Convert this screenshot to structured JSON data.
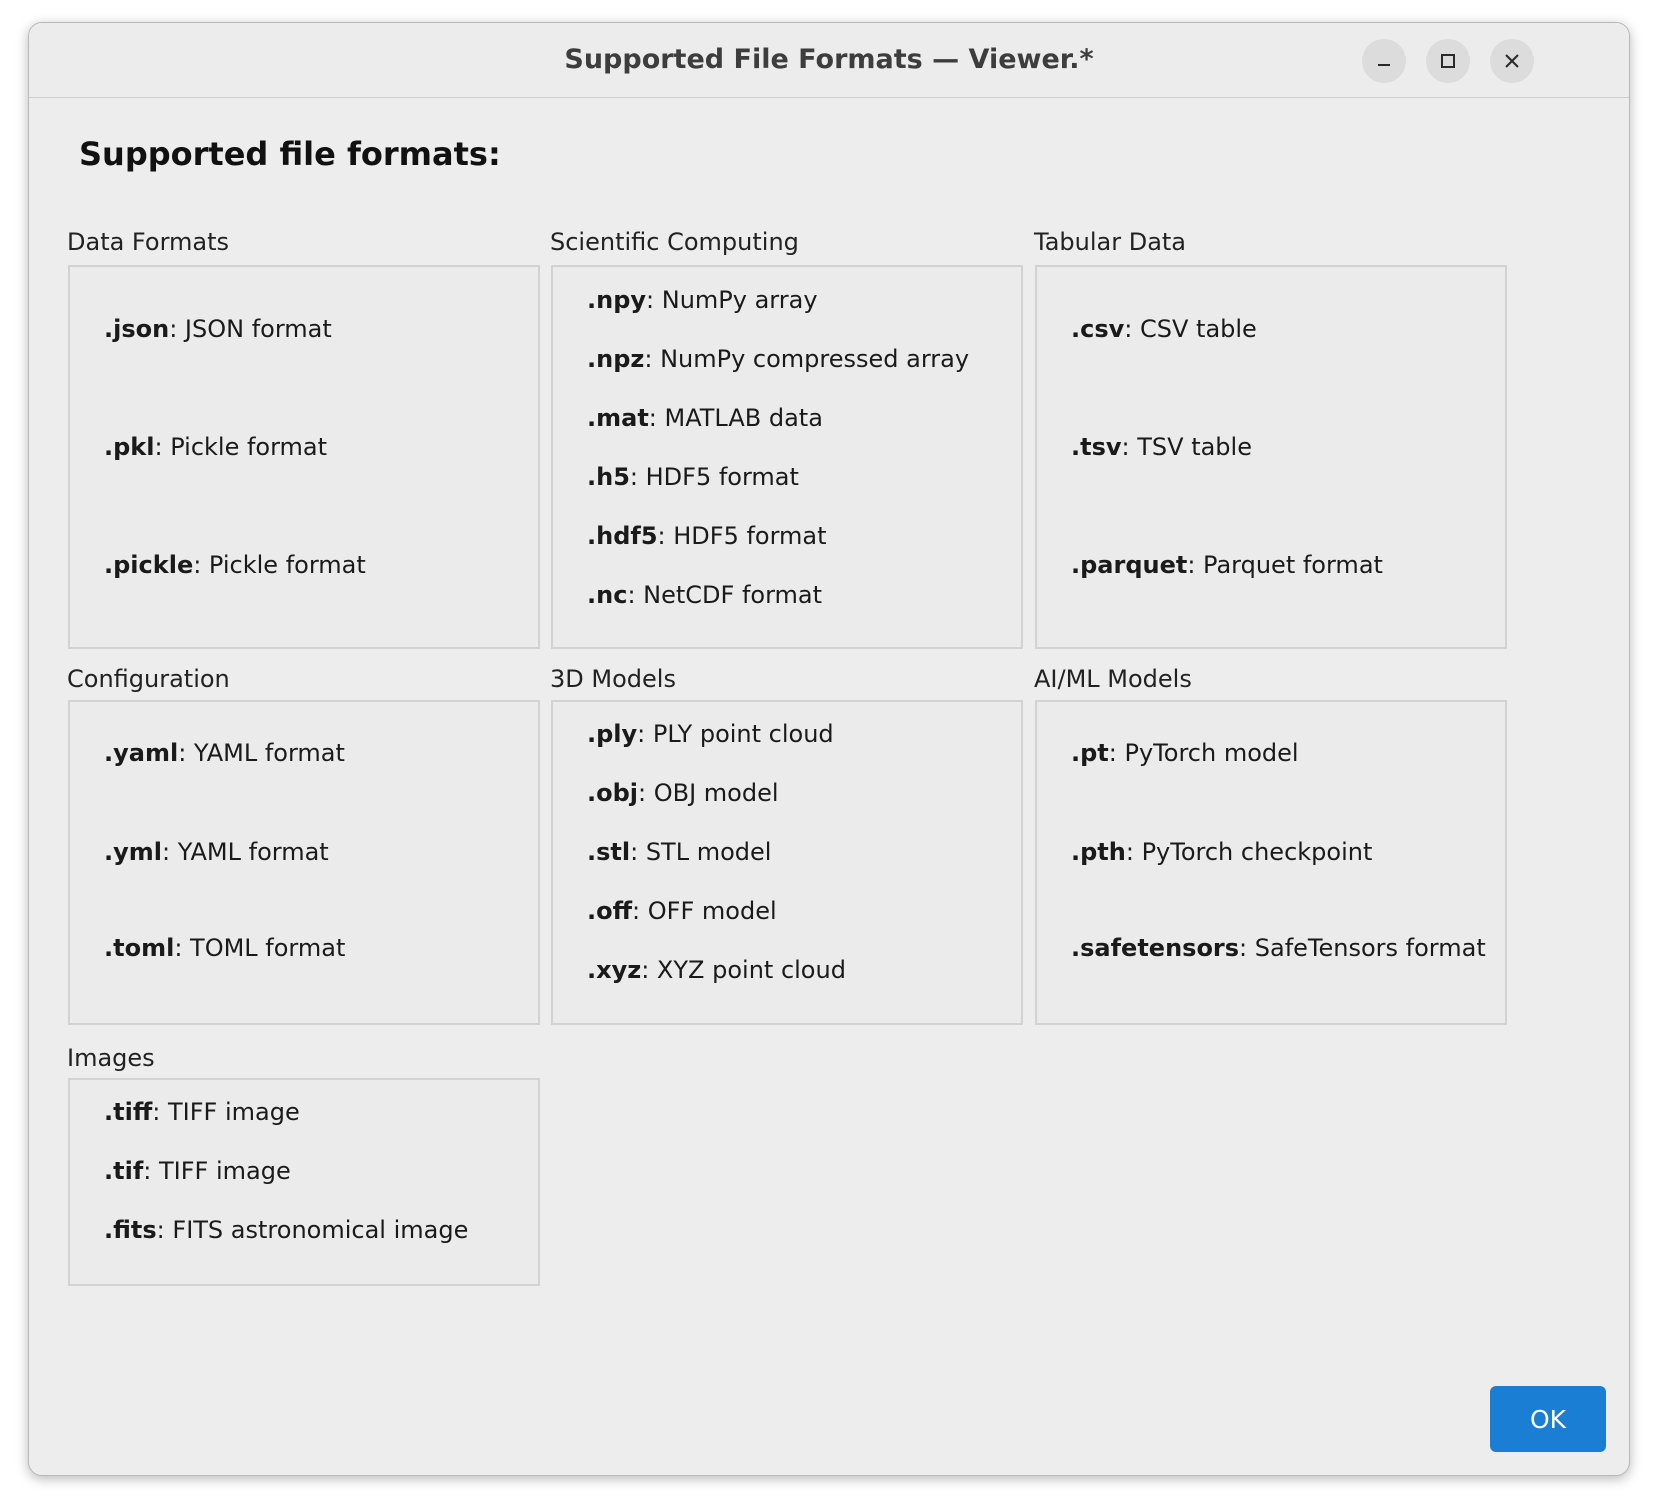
{
  "window": {
    "title": "Supported File Formats — Viewer.*",
    "controls": {
      "minimize": "minimize-icon",
      "maximize": "maximize-icon",
      "close": "close-icon"
    }
  },
  "heading": "Supported file formats:",
  "groups": [
    {
      "label": "Data Formats",
      "items": [
        {
          "ext": ".json",
          "desc": ": JSON format"
        },
        {
          "ext": ".pkl",
          "desc": ": Pickle format"
        },
        {
          "ext": ".pickle",
          "desc": ": Pickle format"
        }
      ]
    },
    {
      "label": "Scientific Computing",
      "items": [
        {
          "ext": ".npy",
          "desc": ": NumPy array"
        },
        {
          "ext": ".npz",
          "desc": ": NumPy compressed array"
        },
        {
          "ext": ".mat",
          "desc": ": MATLAB data"
        },
        {
          "ext": ".h5",
          "desc": ": HDF5 format"
        },
        {
          "ext": ".hdf5",
          "desc": ": HDF5 format"
        },
        {
          "ext": ".nc",
          "desc": ": NetCDF format"
        }
      ]
    },
    {
      "label": "Tabular Data",
      "items": [
        {
          "ext": ".csv",
          "desc": ": CSV table"
        },
        {
          "ext": ".tsv",
          "desc": ": TSV table"
        },
        {
          "ext": ".parquet",
          "desc": ": Parquet format"
        }
      ]
    },
    {
      "label": "Configuration",
      "items": [
        {
          "ext": ".yaml",
          "desc": ": YAML format"
        },
        {
          "ext": ".yml",
          "desc": ": YAML format"
        },
        {
          "ext": ".toml",
          "desc": ": TOML format"
        }
      ]
    },
    {
      "label": "3D Models",
      "items": [
        {
          "ext": ".ply",
          "desc": ": PLY point cloud"
        },
        {
          "ext": ".obj",
          "desc": ": OBJ model"
        },
        {
          "ext": ".stl",
          "desc": ": STL model"
        },
        {
          "ext": ".off",
          "desc": ": OFF model"
        },
        {
          "ext": ".xyz",
          "desc": ": XYZ point cloud"
        }
      ]
    },
    {
      "label": "AI/ML Models",
      "items": [
        {
          "ext": ".pt",
          "desc": ": PyTorch model"
        },
        {
          "ext": ".pth",
          "desc": ": PyTorch checkpoint"
        },
        {
          "ext": ".safetensors",
          "desc": ": SafeTensors format"
        }
      ]
    },
    {
      "label": "Images",
      "items": [
        {
          "ext": ".tiff",
          "desc": ": TIFF image"
        },
        {
          "ext": ".tif",
          "desc": ": TIFF image"
        },
        {
          "ext": ".fits",
          "desc": ": FITS astronomical image"
        }
      ]
    }
  ],
  "ok_button": "OK",
  "colors": {
    "accent": "#1a7fd4",
    "window_bg": "#ededed"
  }
}
